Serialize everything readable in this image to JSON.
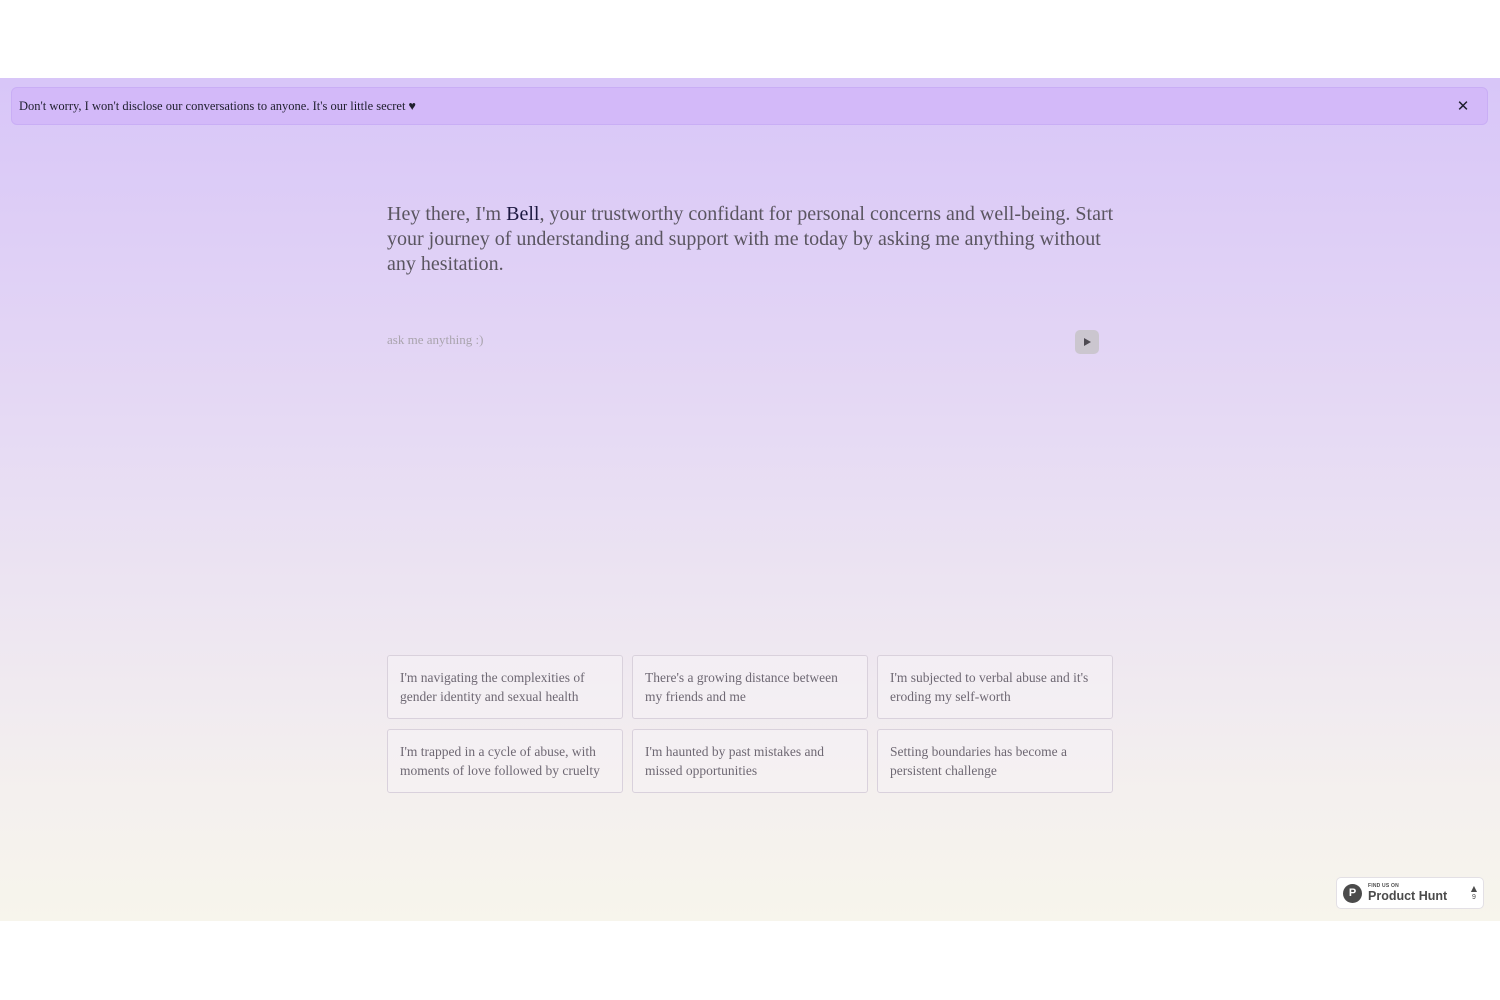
{
  "banner": {
    "text": "Don't worry, I won't disclose our conversations to anyone. It's our little secret ♥",
    "close_icon": "close-icon"
  },
  "intro": {
    "prefix": "Hey there, I'm ",
    "name": "Bell",
    "suffix": ", your trustworthy confidant for personal concerns and well-being. Start your journey of understanding and support with me today by asking me anything without any hesitation."
  },
  "ask": {
    "placeholder": "ask me anything :)",
    "value": "",
    "send_icon": "play-icon"
  },
  "suggestions": [
    "I'm navigating the complexities of gender identity and sexual health",
    "There's a growing distance between my friends and me",
    "I'm subjected to verbal abuse and it's eroding my self-worth",
    "I'm trapped in a cycle of abuse, with moments of love followed by cruelty",
    "I'm haunted by past mistakes and missed opportunities",
    "Setting boundaries has become a persistent challenge"
  ],
  "product_hunt": {
    "logo_letter": "P",
    "find_us": "FIND US ON",
    "name": "Product Hunt",
    "votes": "9"
  },
  "colors": {
    "banner": "#d3b9f9",
    "gradient_top": "#d8c6f8",
    "gradient_bottom": "#f7f5ec",
    "name_accent": "#1c1840"
  }
}
